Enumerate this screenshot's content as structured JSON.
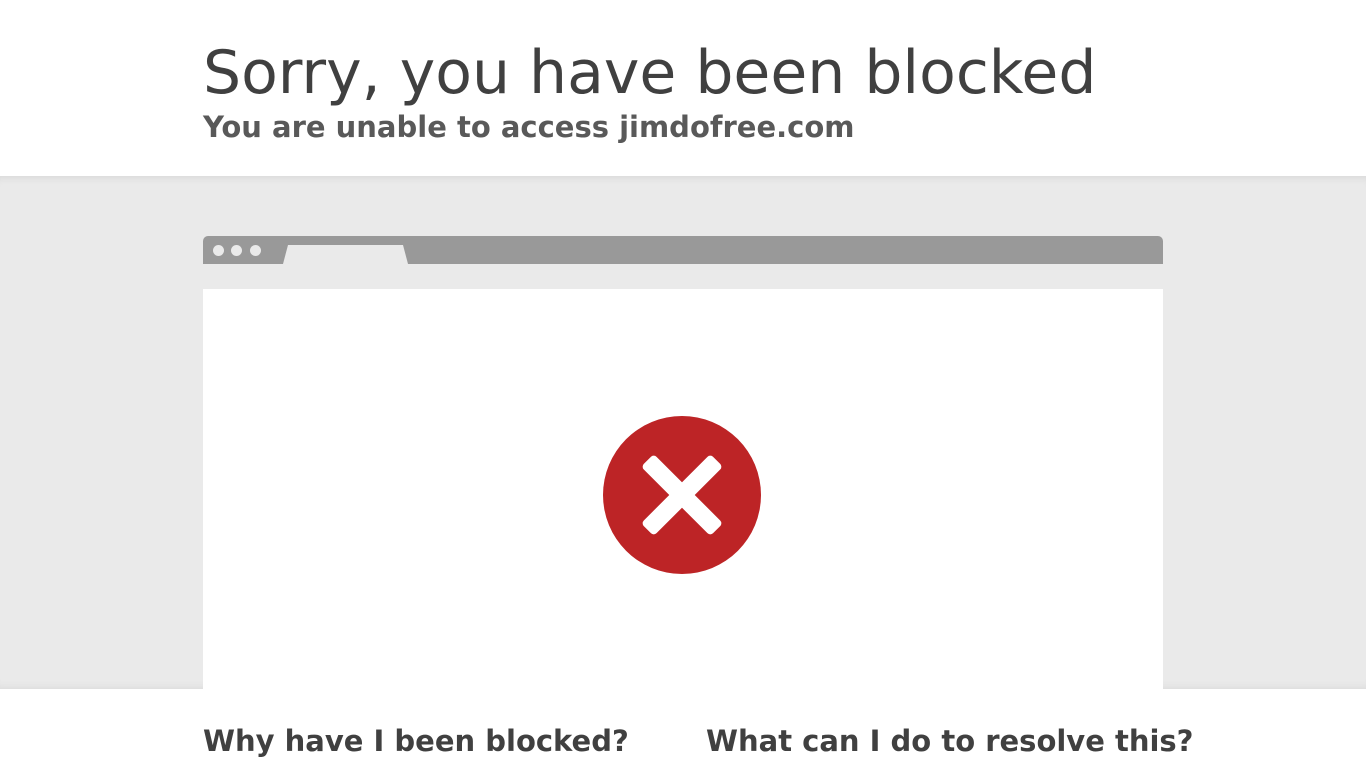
{
  "header": {
    "title": "Sorry, you have been blocked",
    "subtitle": "You are unable to access jimdofree.com"
  },
  "illustration": {
    "icon": "error-x-icon",
    "icon_color": "#bd2426",
    "bar_color": "#999999",
    "background": "#eaeaea"
  },
  "sections": {
    "why_title": "Why have I been blocked?",
    "resolve_title": "What can I do to resolve this?"
  }
}
